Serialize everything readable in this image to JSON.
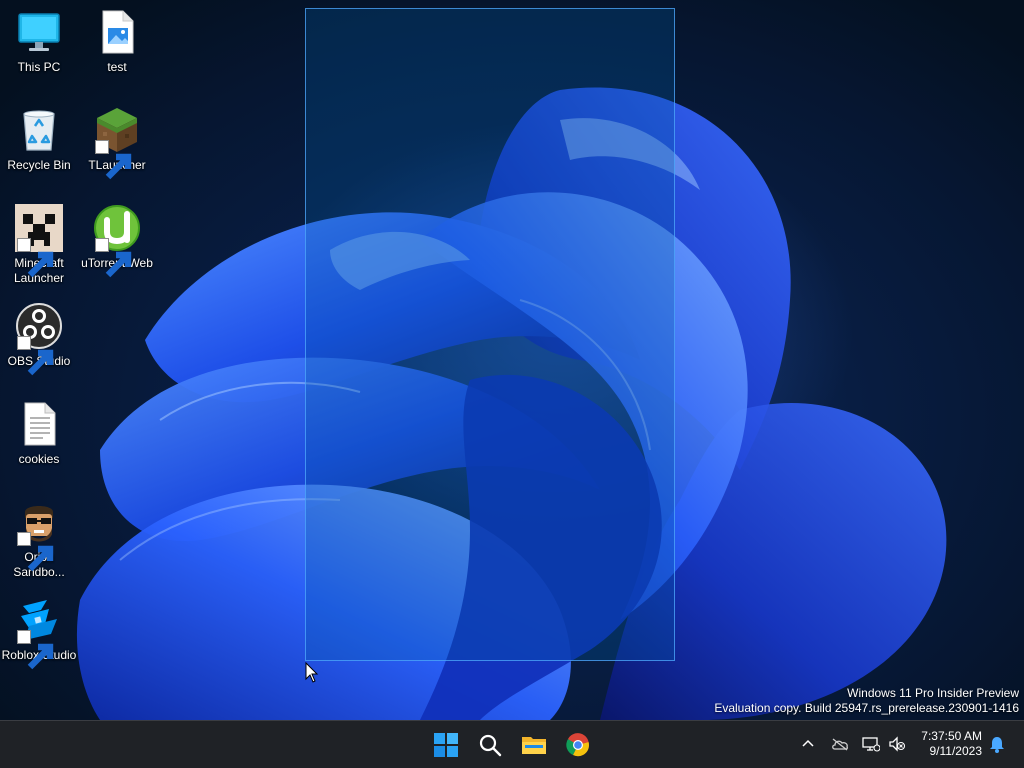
{
  "desktop": {
    "icons": [
      {
        "label": "This PC"
      },
      {
        "label": "test"
      },
      {
        "label": "Recycle Bin"
      },
      {
        "label": "TLauncher"
      },
      {
        "label": "Minecraft Launcher"
      },
      {
        "label": "uTorrent Web"
      },
      {
        "label": "OBS Studio"
      },
      {
        "label": "cookies"
      },
      {
        "label": "Orion Sandbo..."
      },
      {
        "label": "Roblox Studio"
      }
    ]
  },
  "watermark": {
    "line1": "Windows 11 Pro Insider Preview",
    "line2": "Evaluation copy. Build 25947.rs_prerelease.230901-1416"
  },
  "taskbar": {
    "apps": [
      {
        "icon": "windows-start-icon"
      },
      {
        "icon": "search-icon"
      },
      {
        "icon": "file-explorer-icon"
      },
      {
        "icon": "chrome-icon"
      }
    ],
    "tray": {
      "icons": [
        "chevron-up-icon",
        "onedrive-icon",
        "network-icon",
        "volume-muted-icon",
        "notification-bell-icon"
      ],
      "time": "7:37:50 AM",
      "date": "9/11/2023"
    }
  },
  "colors": {
    "taskbar_bg": "#1f2226",
    "selection_border": "#50aaff",
    "wallpaper_accent": "#1e5bff"
  }
}
